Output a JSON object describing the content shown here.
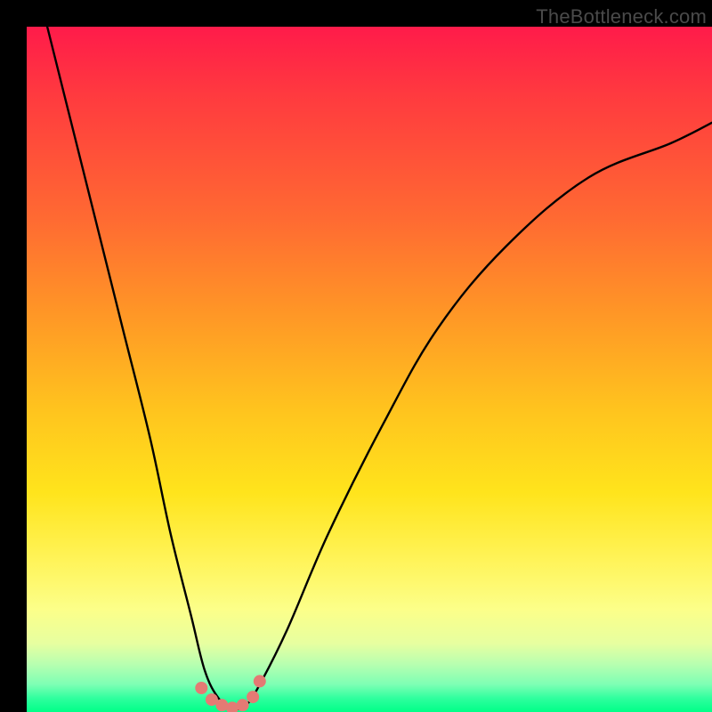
{
  "watermark": "TheBottleneck.com",
  "chart_data": {
    "type": "line",
    "title": "",
    "xlabel": "",
    "ylabel": "",
    "xlim": [
      0,
      100
    ],
    "ylim": [
      0,
      100
    ],
    "grid": false,
    "legend": false,
    "series": [
      {
        "name": "bottleneck-curve",
        "x": [
          3,
          6,
          10,
          14,
          18,
          21,
          24,
          26,
          28,
          30,
          32,
          34,
          38,
          44,
          52,
          60,
          70,
          82,
          94,
          100
        ],
        "y": [
          100,
          88,
          72,
          56,
          40,
          26,
          14,
          6,
          2,
          0.5,
          1,
          4,
          12,
          26,
          42,
          56,
          68,
          78,
          83,
          86
        ]
      }
    ],
    "markers": [
      {
        "name": "valley-point",
        "x": 25.5,
        "y": 3.5
      },
      {
        "name": "valley-point",
        "x": 27.0,
        "y": 1.8
      },
      {
        "name": "valley-point",
        "x": 28.5,
        "y": 1.0
      },
      {
        "name": "valley-point",
        "x": 30.0,
        "y": 0.6
      },
      {
        "name": "valley-point",
        "x": 31.5,
        "y": 1.0
      },
      {
        "name": "valley-point",
        "x": 33.0,
        "y": 2.2
      },
      {
        "name": "valley-point",
        "x": 34.0,
        "y": 4.5
      }
    ],
    "marker_color": "#e47a74",
    "curve_color": "#000000"
  }
}
